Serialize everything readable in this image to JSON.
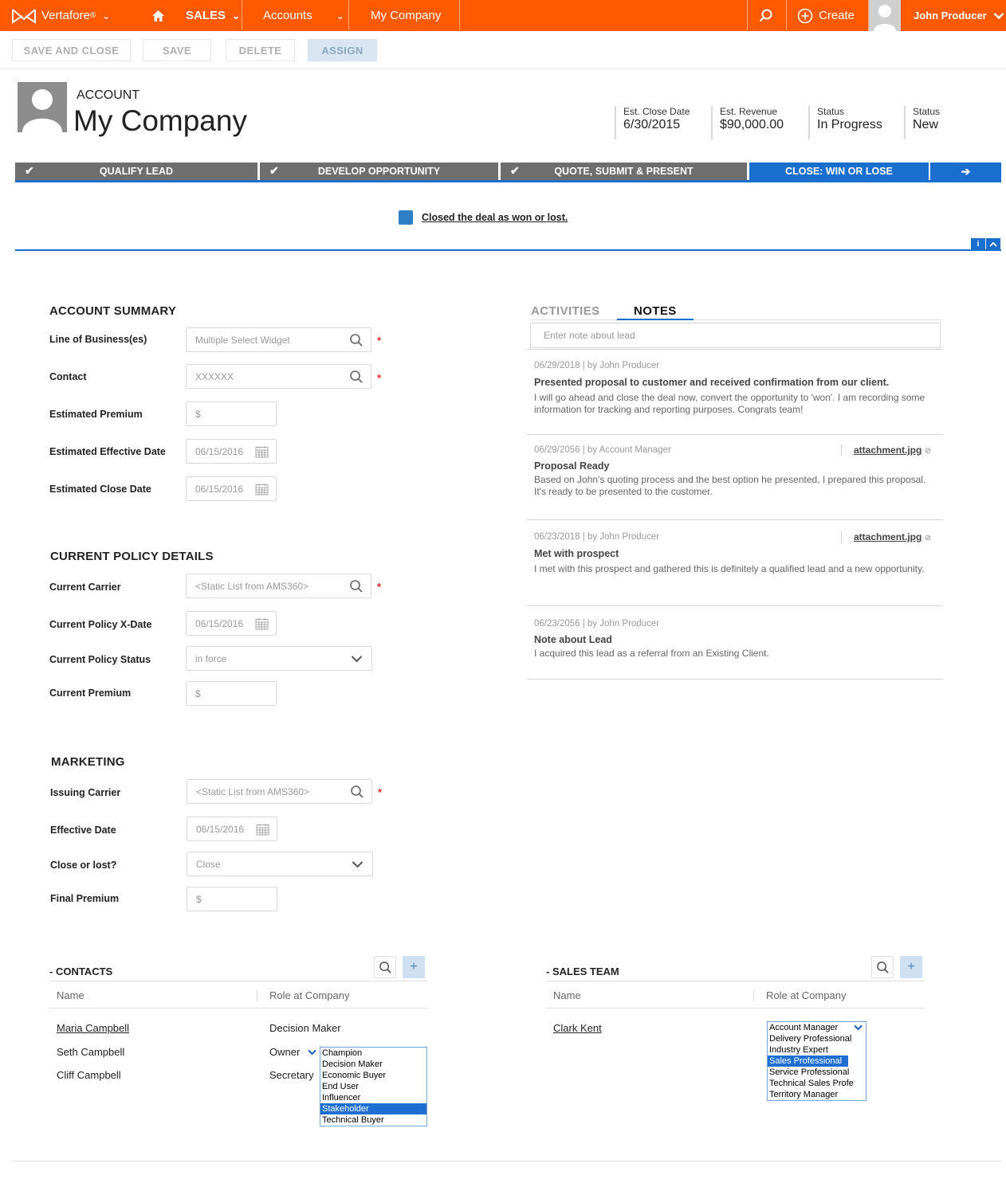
{
  "nav": {
    "brand": "Vertafore",
    "sales": "SALES",
    "accounts": "Accounts",
    "record": "My Company",
    "create": "Create",
    "user": "John Producer"
  },
  "toolbar": {
    "save_close": "SAVE AND CLOSE",
    "save": "SAVE",
    "delete": "DELETE",
    "assign": "ASSIGN"
  },
  "header": {
    "entity_type": "ACCOUNT",
    "entity_name": "My Company",
    "kpis": [
      {
        "label": "Est. Close Date",
        "value": "6/30/2015"
      },
      {
        "label": "Est. Revenue",
        "value": "$90,000.00"
      },
      {
        "label": "Status",
        "value": "In Progress"
      },
      {
        "label": "Status",
        "value": "New"
      }
    ]
  },
  "process": {
    "stages": [
      "QUALIFY LEAD",
      "DEVELOP OPPORTUNITY",
      "QUOTE, SUBMIT & PRESENT",
      "CLOSE: WIN OR LOSE"
    ],
    "active_stage": "CLOSE: WIN OR LOSE",
    "stage_note": "Closed the deal as won or lost.",
    "info_btn": "i"
  },
  "account_summary": {
    "title": "ACCOUNT SUMMARY",
    "fields": [
      {
        "label": "Line of Business(es)",
        "value": "Multiple Select Widget"
      },
      {
        "label": "Contact",
        "value": "XXXXXX"
      },
      {
        "label": "Estimated Premium",
        "value": "$"
      },
      {
        "label": "Estimated Effective Date",
        "value": "06/15/2016"
      },
      {
        "label": "Estimated Close Date",
        "value": "06/15/2016"
      }
    ]
  },
  "current_policy": {
    "title": "CURRENT POLICY DETAILS",
    "fields": [
      {
        "label": "Current Carrier",
        "value": "<Static List from AMS360>"
      },
      {
        "label": "Current Policy X-Date",
        "value": "06/15/2016"
      },
      {
        "label": "Current Policy Status",
        "value": "in force"
      },
      {
        "label": "Current Premium",
        "value": "$"
      }
    ]
  },
  "marketing": {
    "title": "MARKETING",
    "fields": [
      {
        "label": "Issuing Carrier",
        "value": "<Static List from AMS360>"
      },
      {
        "label": "Effective Date",
        "value": "06/15/2016"
      },
      {
        "label": "Close or lost?",
        "value": "Close"
      },
      {
        "label": "Final Premium",
        "value": "$"
      }
    ]
  },
  "notes_panel": {
    "tabs": [
      "ACTIVITIES",
      "NOTES"
    ],
    "active_tab": "NOTES",
    "input_placeholder": "Enter note about lead",
    "notes": [
      {
        "meta": "06/29/2018 | by John Producer",
        "title": "Presented proposal to customer and received confirmation from our client.",
        "body": "I will go ahead and close the deal now, convert the opportunity to 'won'. I am recording some information for tracking and reporting purposes. Congrats team!",
        "attachment": ""
      },
      {
        "meta": "06/29/2056 | by Account Manager",
        "title": "Proposal Ready",
        "body": "Based on John's quoting process and the best option he presented, I prepared this proposal. It's ready to be presented to the customer.",
        "attachment": "attachment.jpg"
      },
      {
        "meta": "06/23/2018 | by John Producer",
        "title": "Met with prospect",
        "body": "I met with this prospect and gathered this is definitely a qualified lead and a new opportunity.",
        "attachment": "attachment.jpg"
      },
      {
        "meta": "06/23/2056 | by John Producer",
        "title": "Note about Lead",
        "body": "I acquired this lead as a referral from an Existing Client.",
        "attachment": ""
      }
    ]
  },
  "contacts": {
    "title": "- CONTACTS",
    "columns": [
      "Name",
      "Role at Company"
    ],
    "rows": [
      {
        "name": "Maria Campbell",
        "role": "Decision Maker"
      },
      {
        "name": "Seth Campbell",
        "role": "Owner"
      },
      {
        "name": "Cliff Campbell",
        "role": "Secretary"
      }
    ],
    "role_options": [
      "Champion",
      "Decision Maker",
      "Economic Buyer",
      "End User",
      "Influencer",
      "Stakeholder",
      "Technical Buyer"
    ],
    "role_selected": "Stakeholder"
  },
  "sales_team": {
    "title": "- SALES TEAM",
    "columns": [
      "Name",
      "Role at Company"
    ],
    "rows": [
      {
        "name": "Clark Kent",
        "role": "Account Manager"
      }
    ],
    "role_options": [
      "Delivery Professional",
      "Industry Expert",
      "Sales Professional",
      "Service Professional",
      "Technical Sales Profe",
      "Territory Manager"
    ],
    "role_selected": "Sales Professional"
  },
  "colors": {
    "brand_orange": "#ff5a00",
    "accent_blue": "#1a6fce",
    "stage_gray": "#6e6e6e",
    "required_red": "#e0262b"
  }
}
